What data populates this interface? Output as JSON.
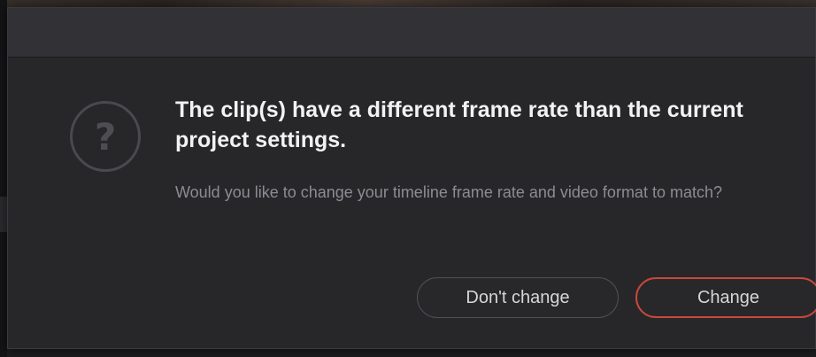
{
  "dialog": {
    "headline": "The clip(s) have a different frame rate than the current project settings.",
    "message": "Would you like to change your timeline frame rate and video format to match?",
    "icon": "question-icon",
    "buttons": {
      "dont_change_label": "Don't change",
      "change_label": "Change"
    },
    "colors": {
      "accent_border": "#c9483c",
      "background": "#27272a",
      "titlebar": "#323236"
    }
  }
}
